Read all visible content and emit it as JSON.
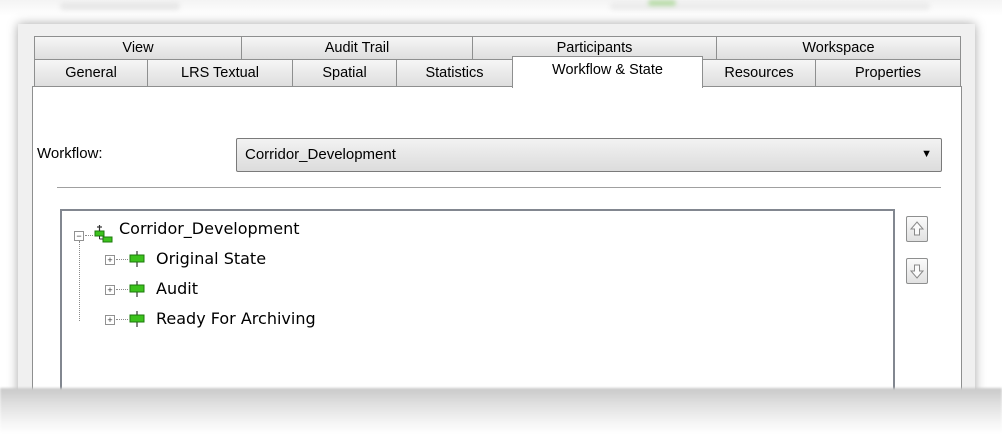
{
  "tabs": {
    "row1": [
      "View",
      "Audit Trail",
      "Participants",
      "Workspace"
    ],
    "row2": [
      "General",
      "LRS Textual",
      "Spatial",
      "Statistics",
      "Workflow & State",
      "Resources",
      "Properties"
    ],
    "active": "Workflow & State"
  },
  "workflow": {
    "label": "Workflow:",
    "selected": "Corridor_Development"
  },
  "tree": {
    "root": "Corridor_Development",
    "states": [
      "Original State",
      "Audit",
      "Ready For Archiving"
    ]
  },
  "icons": {
    "move_up": "arrow-up-icon",
    "move_down": "arrow-down-icon",
    "workflow": "workflow-icon",
    "state": "state-icon",
    "dropdown": "chevron-down-icon"
  },
  "colors": {
    "state_green": "#3cc21d",
    "tab_border": "#8e8f8f"
  }
}
